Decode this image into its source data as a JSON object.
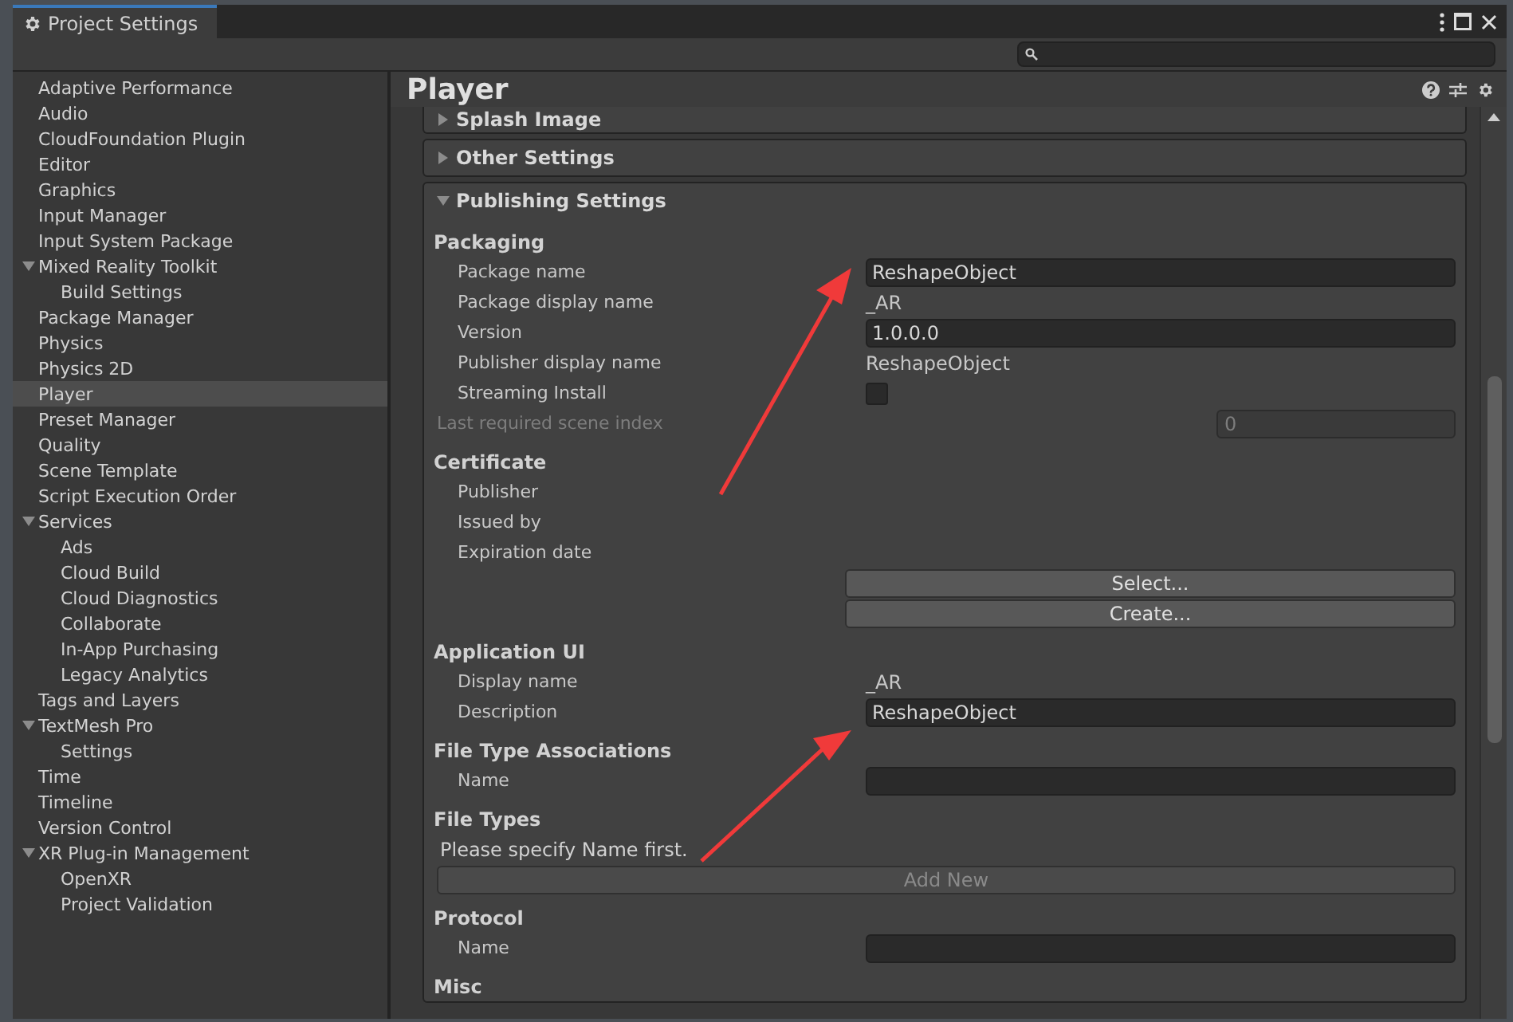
{
  "window": {
    "title": "Project Settings"
  },
  "sidebar": {
    "items": [
      {
        "label": "Adaptive Performance",
        "selected": false
      },
      {
        "label": "Audio",
        "selected": false
      },
      {
        "label": "CloudFoundation Plugin",
        "selected": false
      },
      {
        "label": "Editor",
        "selected": false
      },
      {
        "label": "Graphics",
        "selected": false
      },
      {
        "label": "Input Manager",
        "selected": false
      },
      {
        "label": "Input System Package",
        "selected": false
      },
      {
        "label": "Mixed Reality Toolkit",
        "selected": false,
        "expanded": true,
        "children": [
          {
            "label": "Build Settings",
            "selected": false
          }
        ]
      },
      {
        "label": "Package Manager",
        "selected": false
      },
      {
        "label": "Physics",
        "selected": false
      },
      {
        "label": "Physics 2D",
        "selected": false
      },
      {
        "label": "Player",
        "selected": true
      },
      {
        "label": "Preset Manager",
        "selected": false
      },
      {
        "label": "Quality",
        "selected": false
      },
      {
        "label": "Scene Template",
        "selected": false
      },
      {
        "label": "Script Execution Order",
        "selected": false
      },
      {
        "label": "Services",
        "selected": false,
        "expanded": true,
        "children": [
          {
            "label": "Ads",
            "selected": false
          },
          {
            "label": "Cloud Build",
            "selected": false
          },
          {
            "label": "Cloud Diagnostics",
            "selected": false
          },
          {
            "label": "Collaborate",
            "selected": false
          },
          {
            "label": "In-App Purchasing",
            "selected": false
          },
          {
            "label": "Legacy Analytics",
            "selected": false
          }
        ]
      },
      {
        "label": "Tags and Layers",
        "selected": false
      },
      {
        "label": "TextMesh Pro",
        "selected": false,
        "expanded": true,
        "children": [
          {
            "label": "Settings",
            "selected": false
          }
        ]
      },
      {
        "label": "Time",
        "selected": false
      },
      {
        "label": "Timeline",
        "selected": false
      },
      {
        "label": "Version Control",
        "selected": false
      },
      {
        "label": "XR Plug-in Management",
        "selected": false,
        "expanded": true,
        "children": [
          {
            "label": "OpenXR",
            "selected": false
          },
          {
            "label": "Project Validation",
            "selected": false
          }
        ]
      }
    ]
  },
  "panel": {
    "title": "Player",
    "sections": [
      {
        "title": "Splash Image",
        "expanded": false
      },
      {
        "title": "Other Settings",
        "expanded": false
      },
      {
        "title": "Publishing Settings",
        "expanded": true,
        "rows": [
          {
            "kind": "header",
            "label": "Packaging"
          },
          {
            "kind": "field",
            "label": "Package name",
            "value": "ReshapeObject"
          },
          {
            "kind": "text",
            "label": "Package display name",
            "value": "_AR"
          },
          {
            "kind": "field",
            "label": "Version",
            "value": "1.0.0.0"
          },
          {
            "kind": "text",
            "label": "Publisher display name",
            "value": "ReshapeObject"
          },
          {
            "kind": "checkbox",
            "label": "Streaming Install",
            "checked": false
          },
          {
            "kind": "number",
            "label": "Last required scene index",
            "value": "0",
            "disabled": true
          },
          {
            "kind": "header",
            "label": "Certificate"
          },
          {
            "kind": "label",
            "label": "Publisher"
          },
          {
            "kind": "label",
            "label": "Issued by"
          },
          {
            "kind": "label",
            "label": "Expiration date"
          },
          {
            "kind": "button",
            "label": "Select..."
          },
          {
            "kind": "button",
            "label": "Create..."
          },
          {
            "kind": "header",
            "label": "Application UI"
          },
          {
            "kind": "text",
            "label": "Display name",
            "value": "_AR"
          },
          {
            "kind": "field",
            "label": "Description",
            "value": "ReshapeObject"
          },
          {
            "kind": "header",
            "label": "File Type Associations"
          },
          {
            "kind": "field",
            "label": "Name",
            "value": ""
          },
          {
            "kind": "header",
            "label": "File Types"
          },
          {
            "kind": "note",
            "label": "Please specify Name first."
          },
          {
            "kind": "wide-button",
            "label": "Add New",
            "disabled": true
          },
          {
            "kind": "header",
            "label": "Protocol"
          },
          {
            "kind": "field",
            "label": "Name",
            "value": ""
          },
          {
            "kind": "header",
            "label": "Misc"
          }
        ]
      }
    ]
  }
}
